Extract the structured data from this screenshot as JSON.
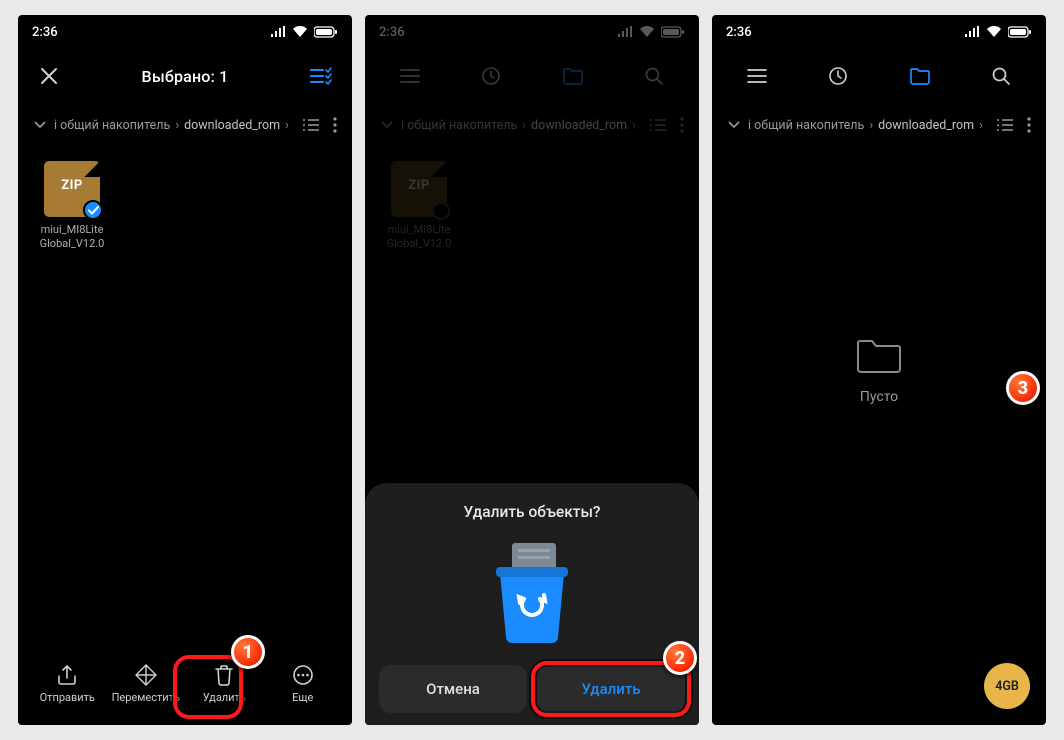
{
  "status": {
    "time": "2:36"
  },
  "screen1": {
    "header_title": "Выбрано: 1",
    "breadcrumb": {
      "prefix": "i общий накопитель",
      "current": "downloaded_rom"
    },
    "file": {
      "ext": "ZIP",
      "name_line1": "miui_MI8Lite",
      "name_line2": "Global_V12.0"
    },
    "actions": {
      "send": "Отправить",
      "move": "Переместить",
      "delete": "Удалить",
      "more": "Еще"
    }
  },
  "screen2": {
    "breadcrumb": {
      "prefix": "i общий накопитель",
      "current": "downloaded_rom"
    },
    "file": {
      "ext": "ZIP",
      "name_line1": "miui_MI8Lite",
      "name_line2": "Global_V12.0"
    },
    "dialog": {
      "title": "Удалить объекты?",
      "cancel": "Отмена",
      "confirm": "Удалить"
    }
  },
  "screen3": {
    "breadcrumb": {
      "prefix": "i общий накопитель",
      "current": "downloaded_rom"
    },
    "empty_label": "Пусто",
    "storage_badge": "4GB"
  },
  "annotations": {
    "badge1": "1",
    "badge2": "2",
    "badge3": "3"
  }
}
